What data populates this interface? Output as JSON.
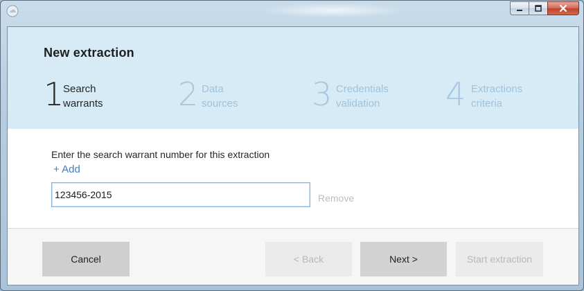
{
  "window": {
    "title": "New extraction",
    "controls": {
      "minimize": "minimize-icon",
      "maximize": "maximize-icon",
      "close": "close-icon"
    }
  },
  "steps": [
    {
      "number": "1",
      "line1": "Search",
      "line2": "warrants",
      "active": true
    },
    {
      "number": "2",
      "line1": "Data",
      "line2": "sources",
      "active": false
    },
    {
      "number": "3",
      "line1": "Credentials",
      "line2": "validation",
      "active": false
    },
    {
      "number": "4",
      "line1": "Extractions",
      "line2": "criteria",
      "active": false
    }
  ],
  "form": {
    "instruction": "Enter the search warrant number for this extraction",
    "add_label": "+ Add",
    "warrant_value": "123456-2015",
    "remove_label": "Remove"
  },
  "footer": {
    "cancel_label": "Cancel",
    "back_label": "<  Back",
    "next_label": "Next  >",
    "start_label": "Start extraction"
  },
  "colors": {
    "header_bg": "#d6ebf5",
    "active_step": "#262626",
    "inactive_step": "#a0c2dd",
    "link": "#3a7fc5"
  }
}
